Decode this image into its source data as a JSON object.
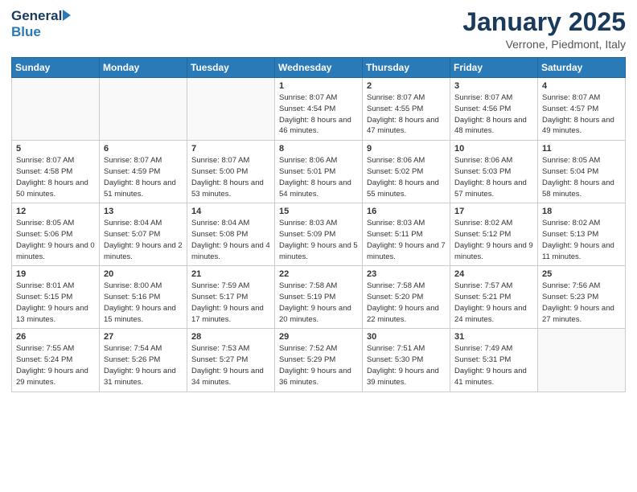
{
  "header": {
    "logo_general": "General",
    "logo_blue": "Blue",
    "month_title": "January 2025",
    "location": "Verrone, Piedmont, Italy"
  },
  "days_of_week": [
    "Sunday",
    "Monday",
    "Tuesday",
    "Wednesday",
    "Thursday",
    "Friday",
    "Saturday"
  ],
  "weeks": [
    [
      {
        "day": "",
        "content": ""
      },
      {
        "day": "",
        "content": ""
      },
      {
        "day": "",
        "content": ""
      },
      {
        "day": "1",
        "content": "Sunrise: 8:07 AM\nSunset: 4:54 PM\nDaylight: 8 hours\nand 46 minutes."
      },
      {
        "day": "2",
        "content": "Sunrise: 8:07 AM\nSunset: 4:55 PM\nDaylight: 8 hours\nand 47 minutes."
      },
      {
        "day": "3",
        "content": "Sunrise: 8:07 AM\nSunset: 4:56 PM\nDaylight: 8 hours\nand 48 minutes."
      },
      {
        "day": "4",
        "content": "Sunrise: 8:07 AM\nSunset: 4:57 PM\nDaylight: 8 hours\nand 49 minutes."
      }
    ],
    [
      {
        "day": "5",
        "content": "Sunrise: 8:07 AM\nSunset: 4:58 PM\nDaylight: 8 hours\nand 50 minutes."
      },
      {
        "day": "6",
        "content": "Sunrise: 8:07 AM\nSunset: 4:59 PM\nDaylight: 8 hours\nand 51 minutes."
      },
      {
        "day": "7",
        "content": "Sunrise: 8:07 AM\nSunset: 5:00 PM\nDaylight: 8 hours\nand 53 minutes."
      },
      {
        "day": "8",
        "content": "Sunrise: 8:06 AM\nSunset: 5:01 PM\nDaylight: 8 hours\nand 54 minutes."
      },
      {
        "day": "9",
        "content": "Sunrise: 8:06 AM\nSunset: 5:02 PM\nDaylight: 8 hours\nand 55 minutes."
      },
      {
        "day": "10",
        "content": "Sunrise: 8:06 AM\nSunset: 5:03 PM\nDaylight: 8 hours\nand 57 minutes."
      },
      {
        "day": "11",
        "content": "Sunrise: 8:05 AM\nSunset: 5:04 PM\nDaylight: 8 hours\nand 58 minutes."
      }
    ],
    [
      {
        "day": "12",
        "content": "Sunrise: 8:05 AM\nSunset: 5:06 PM\nDaylight: 9 hours\nand 0 minutes."
      },
      {
        "day": "13",
        "content": "Sunrise: 8:04 AM\nSunset: 5:07 PM\nDaylight: 9 hours\nand 2 minutes."
      },
      {
        "day": "14",
        "content": "Sunrise: 8:04 AM\nSunset: 5:08 PM\nDaylight: 9 hours\nand 4 minutes."
      },
      {
        "day": "15",
        "content": "Sunrise: 8:03 AM\nSunset: 5:09 PM\nDaylight: 9 hours\nand 5 minutes."
      },
      {
        "day": "16",
        "content": "Sunrise: 8:03 AM\nSunset: 5:11 PM\nDaylight: 9 hours\nand 7 minutes."
      },
      {
        "day": "17",
        "content": "Sunrise: 8:02 AM\nSunset: 5:12 PM\nDaylight: 9 hours\nand 9 minutes."
      },
      {
        "day": "18",
        "content": "Sunrise: 8:02 AM\nSunset: 5:13 PM\nDaylight: 9 hours\nand 11 minutes."
      }
    ],
    [
      {
        "day": "19",
        "content": "Sunrise: 8:01 AM\nSunset: 5:15 PM\nDaylight: 9 hours\nand 13 minutes."
      },
      {
        "day": "20",
        "content": "Sunrise: 8:00 AM\nSunset: 5:16 PM\nDaylight: 9 hours\nand 15 minutes."
      },
      {
        "day": "21",
        "content": "Sunrise: 7:59 AM\nSunset: 5:17 PM\nDaylight: 9 hours\nand 17 minutes."
      },
      {
        "day": "22",
        "content": "Sunrise: 7:58 AM\nSunset: 5:19 PM\nDaylight: 9 hours\nand 20 minutes."
      },
      {
        "day": "23",
        "content": "Sunrise: 7:58 AM\nSunset: 5:20 PM\nDaylight: 9 hours\nand 22 minutes."
      },
      {
        "day": "24",
        "content": "Sunrise: 7:57 AM\nSunset: 5:21 PM\nDaylight: 9 hours\nand 24 minutes."
      },
      {
        "day": "25",
        "content": "Sunrise: 7:56 AM\nSunset: 5:23 PM\nDaylight: 9 hours\nand 27 minutes."
      }
    ],
    [
      {
        "day": "26",
        "content": "Sunrise: 7:55 AM\nSunset: 5:24 PM\nDaylight: 9 hours\nand 29 minutes."
      },
      {
        "day": "27",
        "content": "Sunrise: 7:54 AM\nSunset: 5:26 PM\nDaylight: 9 hours\nand 31 minutes."
      },
      {
        "day": "28",
        "content": "Sunrise: 7:53 AM\nSunset: 5:27 PM\nDaylight: 9 hours\nand 34 minutes."
      },
      {
        "day": "29",
        "content": "Sunrise: 7:52 AM\nSunset: 5:29 PM\nDaylight: 9 hours\nand 36 minutes."
      },
      {
        "day": "30",
        "content": "Sunrise: 7:51 AM\nSunset: 5:30 PM\nDaylight: 9 hours\nand 39 minutes."
      },
      {
        "day": "31",
        "content": "Sunrise: 7:49 AM\nSunset: 5:31 PM\nDaylight: 9 hours\nand 41 minutes."
      },
      {
        "day": "",
        "content": ""
      }
    ]
  ]
}
